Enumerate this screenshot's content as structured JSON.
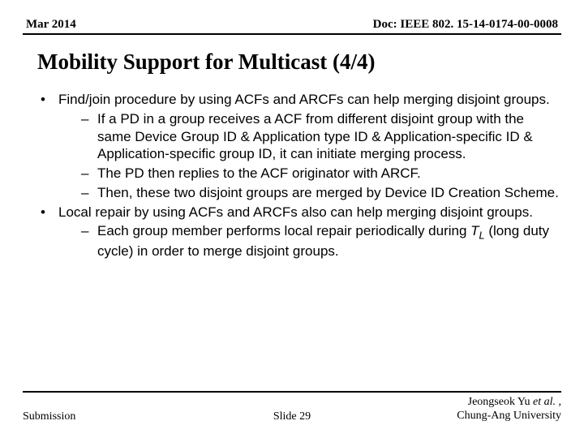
{
  "header": {
    "date": "Mar 2014",
    "doc": "Doc: IEEE 802. 15-14-0174-00-0008"
  },
  "title": "Mobility Support for Multicast (4/4)",
  "bullets": [
    {
      "text": "Find/join procedure by using ACFs and ARCFs can help merging disjoint groups.",
      "sub": [
        "If a PD in a group receives a ACF from different disjoint group with the same Device Group ID & Application type ID & Application-specific ID & Application-specific group ID, it can initiate merging process.",
        "The PD then replies to the ACF originator with ARCF.",
        "Then, these two disjoint groups are merged by Device ID Creation Scheme."
      ]
    },
    {
      "text": "Local repair by using ACFs and ARCFs also can help merging disjoint groups.",
      "sub_html": [
        "Each group member performs local repair periodically during <span class=\"tl\">T</span><span class=\"tl-sub\">L</span> (long duty cycle) in order to merge disjoint groups."
      ]
    }
  ],
  "footer": {
    "left": "Submission",
    "center": "Slide 29",
    "right_line1_pre": "Jeongseok Yu ",
    "right_line1_etal": "et al.",
    "right_line1_post": " ,",
    "right_line2": "Chung-Ang University"
  }
}
